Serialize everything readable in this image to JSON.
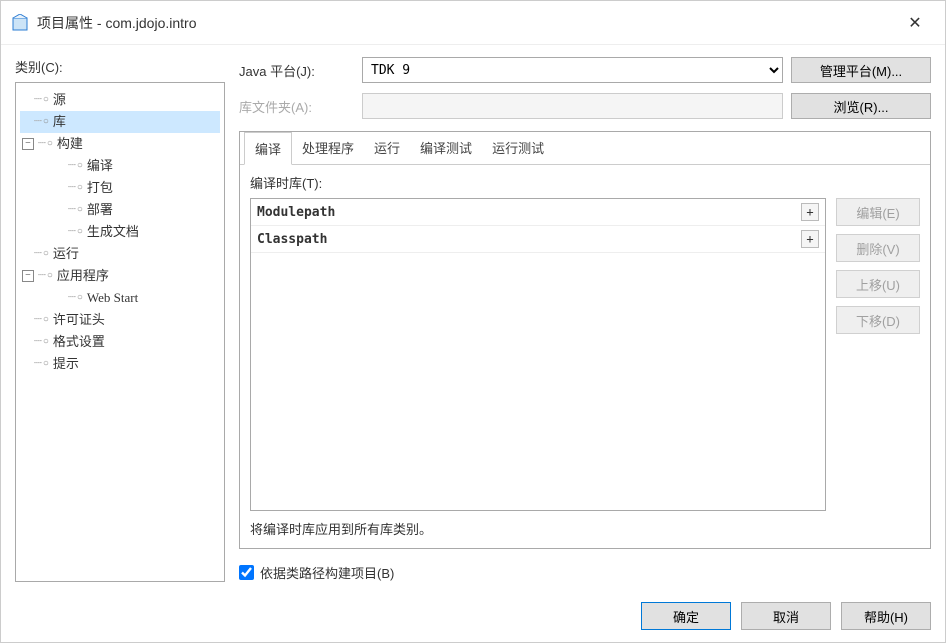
{
  "window": {
    "title": "项目属性 - com.jdojo.intro"
  },
  "sidebar": {
    "label": "类别(C):",
    "items": [
      {
        "label": "源",
        "level": 1
      },
      {
        "label": "库",
        "level": 1,
        "selected": true
      },
      {
        "label": "构建",
        "level": 1,
        "expandable": true
      },
      {
        "label": "编译",
        "level": 2
      },
      {
        "label": "打包",
        "level": 2
      },
      {
        "label": "部署",
        "level": 2
      },
      {
        "label": "生成文档",
        "level": 2
      },
      {
        "label": "运行",
        "level": 1
      },
      {
        "label": "应用程序",
        "level": 1,
        "expandable": true
      },
      {
        "label": "Web Start",
        "level": 2
      },
      {
        "label": "许可证头",
        "level": 1
      },
      {
        "label": "格式设置",
        "level": 1
      },
      {
        "label": "提示",
        "level": 1
      }
    ]
  },
  "form": {
    "java_platform_label": "Java 平台(J):",
    "java_platform_value": "TDK 9",
    "manage_platform_btn": "管理平台(M)...",
    "lib_folder_label": "库文件夹(A):",
    "lib_folder_value": "",
    "browse_btn": "浏览(R)..."
  },
  "tabs": {
    "items": [
      "编译",
      "处理程序",
      "运行",
      "编译测试",
      "运行测试"
    ],
    "active": 0,
    "compile_label": "编译时库(T):",
    "lib_entries": [
      "Modulepath",
      "Classpath"
    ],
    "side_buttons": {
      "edit": "编辑(E)",
      "delete": "删除(V)",
      "up": "上移(U)",
      "down": "下移(D)"
    },
    "apply_note": "将编译时库应用到所有库类别。"
  },
  "checkbox": {
    "label": "依据类路径构建项目(B)",
    "checked": true
  },
  "footer": {
    "ok": "确定",
    "cancel": "取消",
    "help": "帮助(H)"
  }
}
